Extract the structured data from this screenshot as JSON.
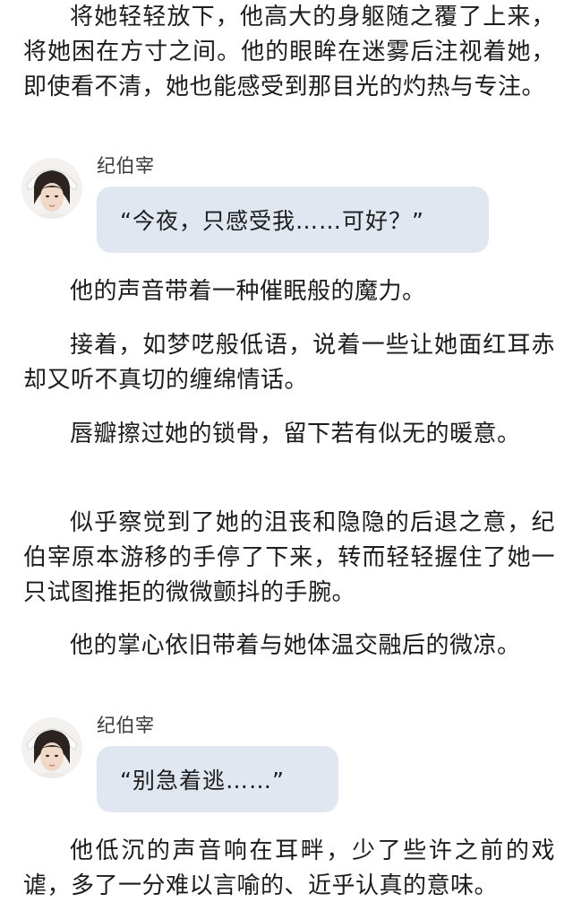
{
  "paragraphs": [
    "将她轻轻放下，他高大的身躯随之覆了上来，将她困在方寸之间。他的眼眸在迷雾后注视着她，即使看不清，她也能感受到那目光的灼热与专注。",
    "他的声音带着一种催眠般的魔力。",
    "接着，如梦呓般低语，说着一些让她面红耳赤却又听不真切的缠绵情话。",
    "唇瓣擦过她的锁骨，留下若有似无的暖意。",
    "似乎察觉到了她的沮丧和隐隐的后退之意，纪伯宰原本游移的手停了下来，转而轻轻握住了她一只试图推拒的微微颤抖的手腕。",
    "他的掌心依旧带着与她体温交融后的微凉。",
    "他低沉的声音响在耳畔，少了些许之前的戏谑，多了一分难以言喻的、近乎认真的意味。"
  ],
  "dialogues": [
    {
      "speaker": "纪伯宰",
      "text": "“今夜，只感受我……可好？”"
    },
    {
      "speaker": "纪伯宰",
      "text": "“别急着逃……”"
    }
  ]
}
